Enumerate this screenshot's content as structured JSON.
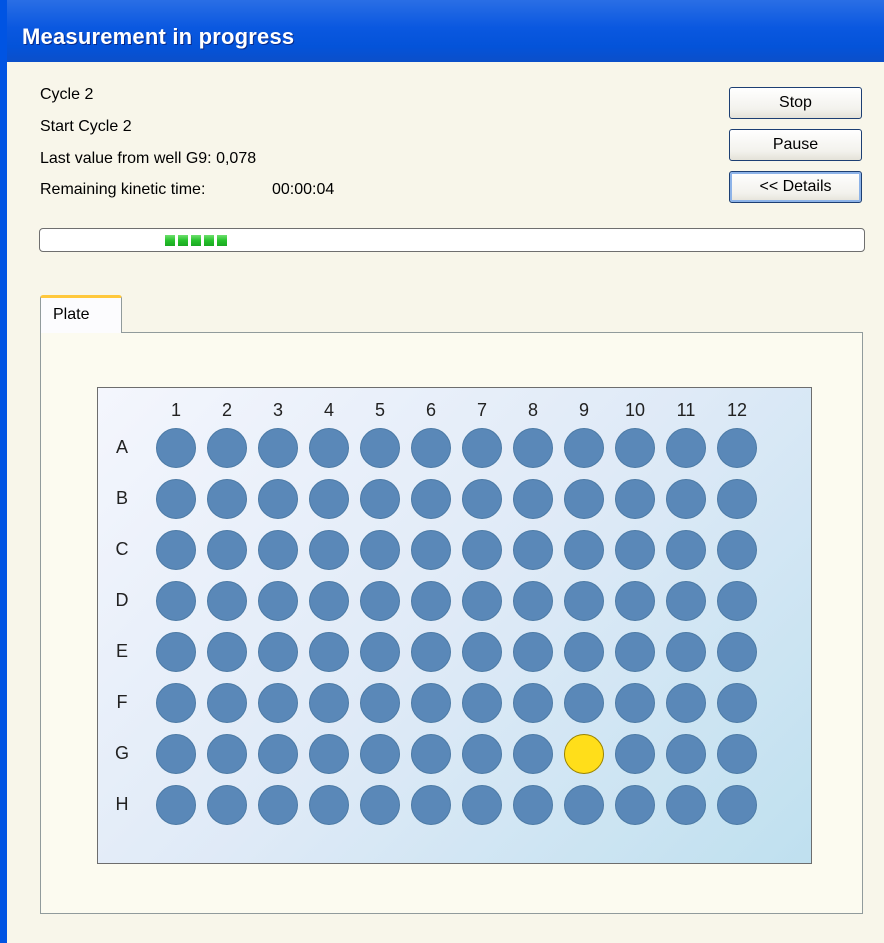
{
  "window": {
    "title": "Measurement in progress"
  },
  "status": {
    "cycle": "Cycle 2",
    "start_cycle": "Start Cycle 2",
    "last_value": "Last value from well G9: 0,078",
    "remaining_label": "Remaining kinetic time:",
    "remaining_time": "00:00:04"
  },
  "buttons": {
    "stop": "Stop",
    "pause": "Pause",
    "details": "<< Details"
  },
  "progress": {
    "chunks": 5
  },
  "tabs": [
    {
      "label": "Plate",
      "active": true
    }
  ],
  "plate": {
    "columns": [
      "1",
      "2",
      "3",
      "4",
      "5",
      "6",
      "7",
      "8",
      "9",
      "10",
      "11",
      "12"
    ],
    "rows": [
      "A",
      "B",
      "C",
      "D",
      "E",
      "F",
      "G",
      "H"
    ],
    "active_well": "G9",
    "colors": {
      "well": "#5a88b8",
      "active_well": "#ffde1a",
      "active_border": "#9a8400"
    }
  }
}
